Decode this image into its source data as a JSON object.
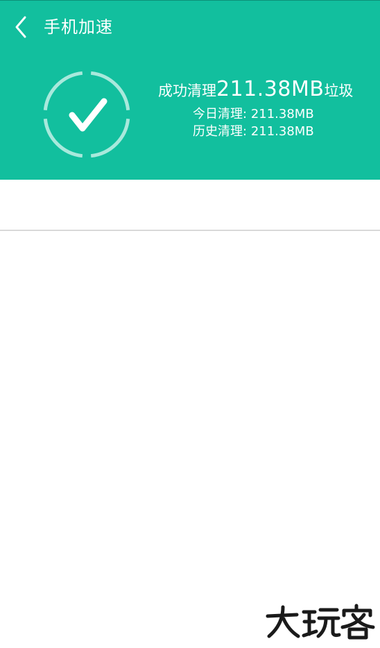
{
  "header": {
    "title": "手机加速",
    "back_icon": "chevron-left-icon",
    "bg_color": "#12bf9e"
  },
  "result": {
    "status_icon": "check-circle-icon",
    "prefix": "成功清理",
    "amount": "211.38MB",
    "suffix": "垃圾",
    "today_label": "今日清理:",
    "today_value": "211.38MB",
    "history_label": "历史清理:",
    "history_value": "211.38MB"
  },
  "watermark": {
    "text": "大玩客"
  }
}
